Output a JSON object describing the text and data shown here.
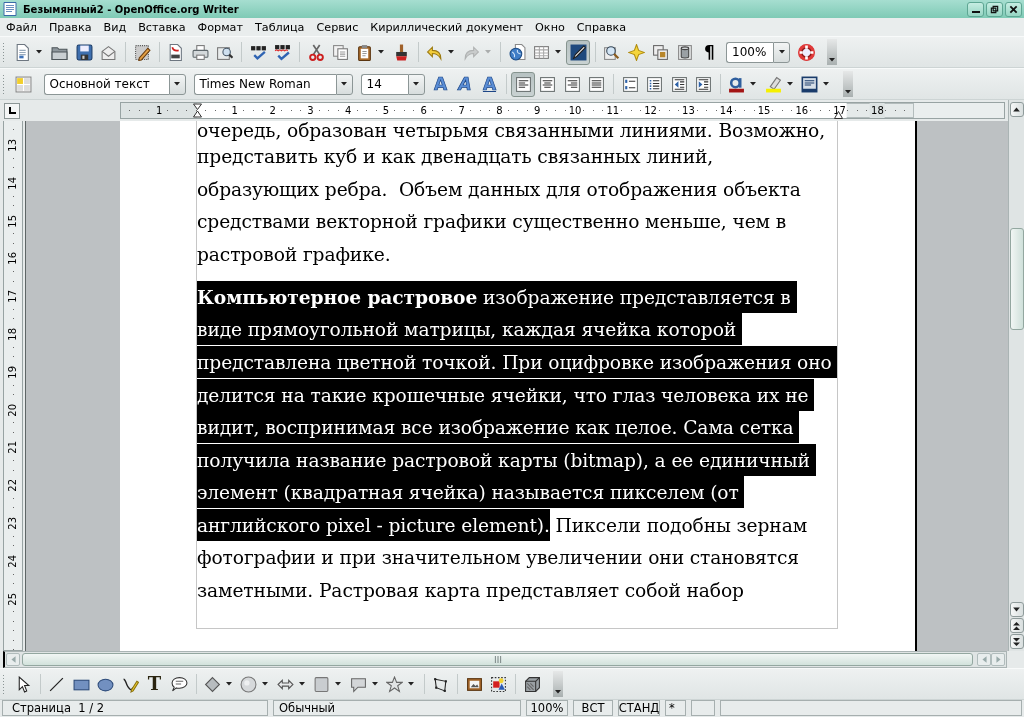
{
  "window": {
    "title": "Безымянный2 - OpenOffice.org Writer"
  },
  "menu": [
    "Файл",
    "Правка",
    "Вид",
    "Вставка",
    "Формат",
    "Таблица",
    "Сервис",
    "Кириллический документ",
    "Окно",
    "Справка"
  ],
  "standard_toolbar": {
    "buttons": [
      {
        "pressed": false,
        "disabled": false
      },
      {
        "pressed": false,
        "disabled": false
      },
      {
        "pressed": false,
        "disabled": false
      },
      {
        "pressed": false,
        "disabled": false
      },
      {
        "pressed": false,
        "disabled": false
      },
      {
        "pressed": false,
        "disabled": false
      },
      {
        "pressed": false,
        "disabled": false
      },
      {
        "pressed": false,
        "disabled": false
      },
      {
        "pressed": false,
        "disabled": false
      },
      {
        "pressed": false,
        "disabled": false
      },
      {
        "pressed": false,
        "disabled": false
      },
      {
        "pressed": false,
        "disabled": false
      },
      {
        "pressed": false,
        "disabled": false
      },
      {
        "pressed": false,
        "disabled": false
      },
      {
        "pressed": false,
        "disabled": false
      },
      {
        "pressed": false,
        "disabled": true
      },
      {
        "pressed": false,
        "disabled": false
      },
      {
        "pressed": false,
        "disabled": false
      },
      {
        "pressed": true,
        "disabled": false
      },
      {
        "pressed": false,
        "disabled": false
      },
      {
        "pressed": false,
        "disabled": false
      },
      {
        "pressed": false,
        "disabled": false
      },
      {
        "pressed": false,
        "disabled": false
      },
      {
        "pressed": false,
        "disabled": false,
        "label": "¶"
      },
      {
        "pressed": false,
        "disabled": false
      }
    ],
    "zoom": "100%"
  },
  "formatting_toolbar": {
    "paragraph_style": "Основной текст",
    "font_name": "Times New Roman",
    "font_size": "14",
    "buttons": [
      {
        "pressed": false
      },
      {
        "pressed": false,
        "label": "A"
      },
      {
        "pressed": false,
        "label": "A"
      },
      {
        "pressed": false,
        "label": "A"
      },
      {
        "pressed": true
      },
      {
        "pressed": false
      },
      {
        "pressed": false
      },
      {
        "pressed": false
      },
      {
        "pressed": false
      },
      {
        "pressed": false
      },
      {
        "pressed": false
      },
      {
        "pressed": false
      },
      {
        "pressed": false
      },
      {
        "pressed": false
      },
      {
        "pressed": false
      }
    ]
  },
  "ruler": [
    "1",
    "1",
    "2",
    "3",
    "4",
    "5",
    "6",
    "7",
    "8",
    "9",
    "10",
    "11",
    "12",
    "13",
    "14",
    "15",
    "16",
    "17",
    "18"
  ],
  "vertical_ruler": [
    "13",
    "14",
    "15",
    "16",
    "17",
    "18",
    "19",
    "20",
    "21",
    "22",
    "23",
    "24",
    "25"
  ],
  "document": {
    "cut_off_line": "очередь, образован четырьмя связанными линиями. Возможно,",
    "paragraphs": [
      {
        "runs": [
          {
            "text": "представить куб и как двенадцать связанных линий, образующих ребра.  Объем данных для отображения объекта средствами векторной графики существенно меньше, чем в растровой графике.",
            "selected": false
          }
        ]
      },
      {
        "runs": [
          {
            "text": "**Компьютерное растровое** изображение представляется в виде прямоугольной матрицы, каждая ячейка которой представлена цветной точкой. При оцифровке изображения оно делится на такие крошечные ячейки, что глаз человека их не видит, воспринимая все изображение как целое. Сама сетка получила название растровой карты (bitmap), а ее единичный элемент (квадратная ячейка) называется пикселем (от английского pixel - picture element).",
            "selected": true
          },
          {
            "text": " Пиксели подобны зернам фотографии и при значительном увеличении они становятся заметными. Растровая карта представляет собой набор",
            "selected": false
          }
        ]
      }
    ]
  },
  "drawing_toolbar": {
    "buttons": [
      {
        "pressed": false
      },
      {
        "pressed": false
      },
      {
        "pressed": false
      },
      {
        "pressed": false
      },
      {
        "pressed": false
      },
      {
        "pressed": false,
        "label": "T"
      },
      {
        "pressed": false
      },
      {
        "pressed": false
      },
      {
        "pressed": false
      },
      {
        "pressed": false
      },
      {
        "pressed": false
      },
      {
        "pressed": false
      },
      {
        "pressed": false
      },
      {
        "pressed": false
      },
      {
        "pressed": false
      },
      {
        "pressed": false
      },
      {
        "pressed": false
      }
    ]
  },
  "status_bar": [
    "Страница  1 / 2",
    "Обычный",
    "100%",
    "ВСТ",
    "СТАНД",
    "*"
  ]
}
